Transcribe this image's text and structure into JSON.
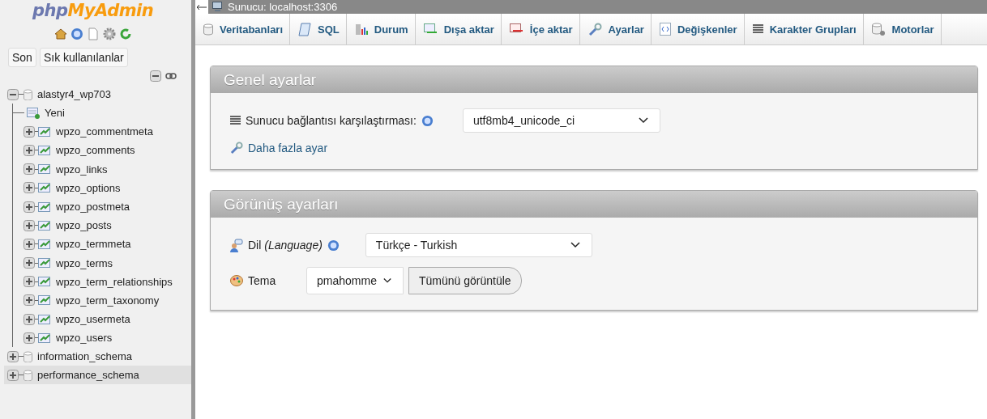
{
  "logo": {
    "part_1": "php",
    "part_2": "MyAdmin"
  },
  "recent_buttons": [
    "Son",
    "Sık kullanılanlar"
  ],
  "tree": [
    {
      "label": "alastyr4_wp703",
      "kind": "database",
      "expanded": true,
      "selected": false,
      "children": [
        {
          "label": "Yeni",
          "kind": "new"
        },
        {
          "label": "wpzo_commentmeta",
          "kind": "table",
          "expanded": false
        },
        {
          "label": "wpzo_comments",
          "kind": "table",
          "expanded": false
        },
        {
          "label": "wpzo_links",
          "kind": "table",
          "expanded": false
        },
        {
          "label": "wpzo_options",
          "kind": "table",
          "expanded": false
        },
        {
          "label": "wpzo_postmeta",
          "kind": "table",
          "expanded": false
        },
        {
          "label": "wpzo_posts",
          "kind": "table",
          "expanded": false
        },
        {
          "label": "wpzo_termmeta",
          "kind": "table",
          "expanded": false
        },
        {
          "label": "wpzo_terms",
          "kind": "table",
          "expanded": false
        },
        {
          "label": "wpzo_term_relationships",
          "kind": "table",
          "expanded": false
        },
        {
          "label": "wpzo_term_taxonomy",
          "kind": "table",
          "expanded": false
        },
        {
          "label": "wpzo_usermeta",
          "kind": "table",
          "expanded": false
        },
        {
          "label": "wpzo_users",
          "kind": "table",
          "expanded": false
        }
      ]
    },
    {
      "label": "information_schema",
      "kind": "database",
      "expanded": false,
      "selected": false
    },
    {
      "label": "performance_schema",
      "kind": "database",
      "expanded": false,
      "selected": true
    }
  ],
  "breadcrumb": "Sunucu: localhost:3306",
  "tabs": [
    {
      "label": "Veritabanları",
      "selected": false
    },
    {
      "label": "SQL",
      "selected": false
    },
    {
      "label": "Durum",
      "selected": false
    },
    {
      "label": "Dışa aktar",
      "selected": false
    },
    {
      "label": "İçe aktar",
      "selected": false
    },
    {
      "label": "Ayarlar",
      "selected": false
    },
    {
      "label": "Değişkenler",
      "selected": false
    },
    {
      "label": "Karakter Grupları",
      "selected": false
    },
    {
      "label": "Motorlar",
      "selected": false
    }
  ],
  "panels": [
    {
      "title": "Genel ayarlar",
      "rows": [
        {
          "kind": "select",
          "label": "Sunucu bağlantısı karşılaştırması:",
          "help": true,
          "value": "utf8mb4_unicode_ci"
        },
        {
          "kind": "link",
          "label": "Daha fazla ayar"
        }
      ]
    },
    {
      "title": "Görünüş ayarları",
      "rows": [
        {
          "kind": "select",
          "label": "Dil *(Language)*",
          "help": true,
          "value": "Türkçe - Turkish"
        },
        {
          "kind": "theme",
          "label": "Tema",
          "value": "pmahomme",
          "button": "Tümünü görüntüle"
        }
      ]
    }
  ]
}
